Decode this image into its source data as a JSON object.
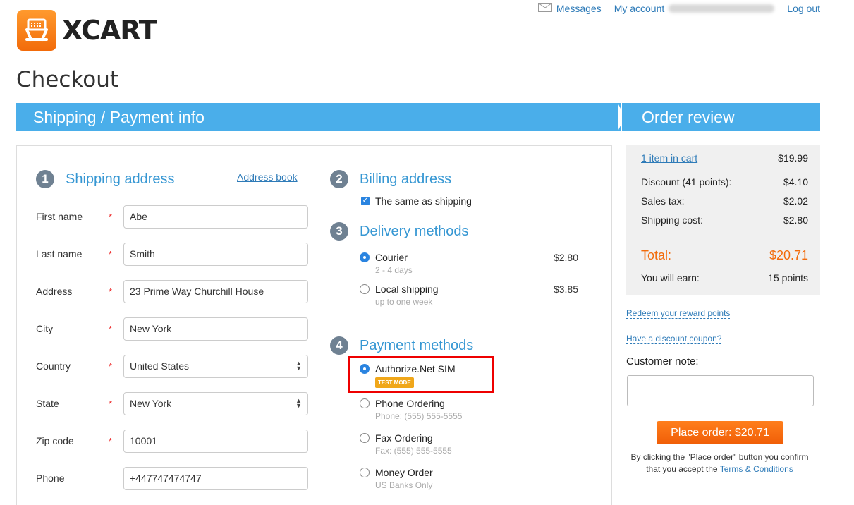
{
  "brand": {
    "name": "XCART"
  },
  "top_nav": {
    "messages": "Messages",
    "my_account": "My account",
    "logout": "Log out"
  },
  "page_title": "Checkout",
  "steps": {
    "step1": "Shipping / Payment info",
    "step2": "Order review"
  },
  "shipping": {
    "number": "1",
    "title": "Shipping address",
    "address_book": "Address book",
    "fields": [
      {
        "label": "First name",
        "value": "Abe"
      },
      {
        "label": "Last name",
        "value": "Smith"
      },
      {
        "label": "Address",
        "value": "23 Prime Way Churchill House"
      },
      {
        "label": "City",
        "value": "New York"
      },
      {
        "label": "Country",
        "value": "United States"
      },
      {
        "label": "State",
        "value": "New York"
      },
      {
        "label": "Zip code",
        "value": "10001"
      },
      {
        "label": "Phone",
        "value": "+447747474747"
      }
    ],
    "required_mark": "*"
  },
  "billing": {
    "number": "2",
    "title": "Billing address",
    "same_as_shipping": "The same as shipping"
  },
  "delivery": {
    "number": "3",
    "title": "Delivery methods",
    "options": [
      {
        "label": "Courier",
        "sub": "2 - 4 days",
        "price": "$2.80",
        "selected": true
      },
      {
        "label": "Local shipping",
        "sub": "up to one week",
        "price": "$3.85",
        "selected": false
      }
    ]
  },
  "payment": {
    "number": "4",
    "title": "Payment methods",
    "options": [
      {
        "label": "Authorize.Net SIM",
        "badge": "TEST MODE",
        "selected": true
      },
      {
        "label": "Phone Ordering",
        "sub": "Phone: (555) 555-5555",
        "selected": false
      },
      {
        "label": "Fax Ordering",
        "sub": "Fax: (555) 555-5555",
        "selected": false
      },
      {
        "label": "Money Order",
        "sub": "US Banks Only",
        "selected": false
      }
    ]
  },
  "summary": {
    "items_in_cart": "1 item in cart",
    "items_amount": "$19.99",
    "discount_label": "Discount (41 points):",
    "discount_amount": "$4.10",
    "tax_label": "Sales tax:",
    "tax_amount": "$2.02",
    "shipping_label": "Shipping cost:",
    "shipping_amount": "$2.80",
    "total_label": "Total:",
    "total_amount": "$20.71",
    "earn_label": "You will earn:",
    "earn_amount": "15 points"
  },
  "side": {
    "redeem": "Redeem your reward points",
    "coupon": "Have a discount coupon?",
    "note_label": "Customer note:",
    "place_order": "Place order: $20.71",
    "terms_prefix": "By clicking the \"Place order\" button you confirm that you accept the",
    "terms_link": "Terms & Conditions"
  },
  "colors": {
    "accent": "#4aaeea",
    "orange": "#f26b0a",
    "link": "#2e7bb8"
  }
}
